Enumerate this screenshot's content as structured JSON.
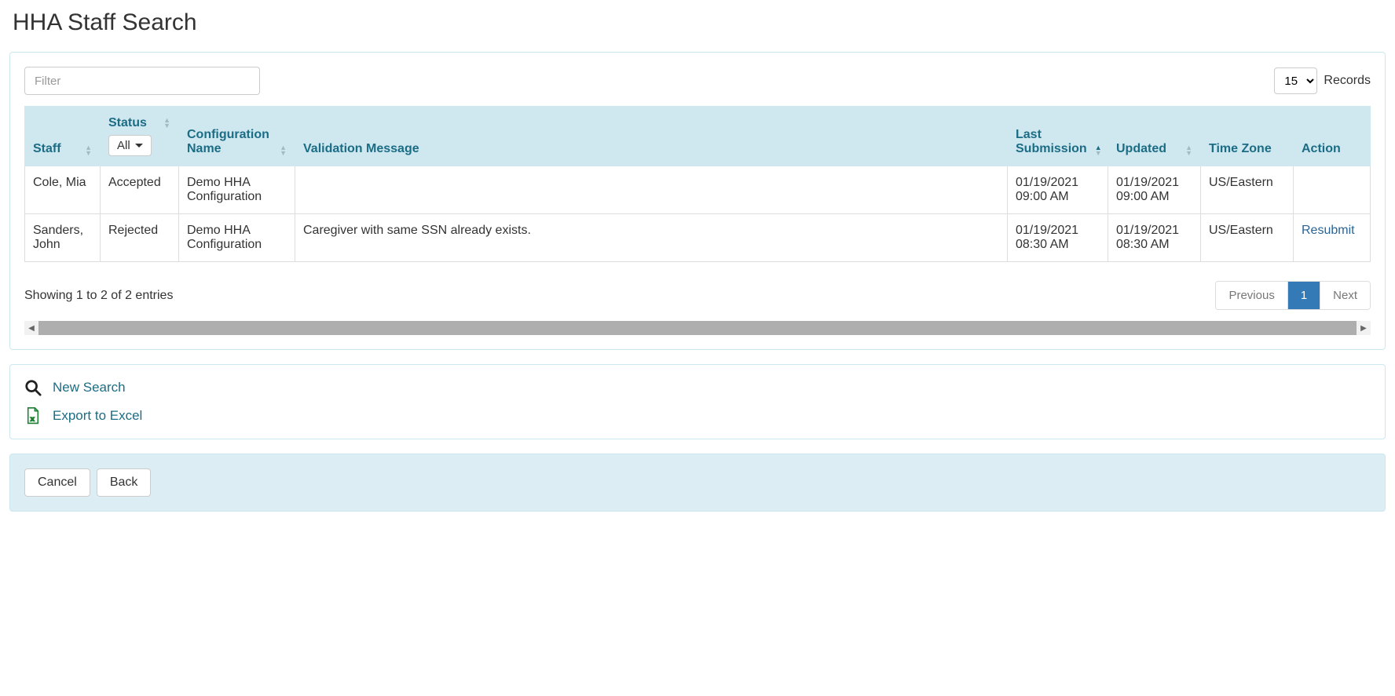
{
  "title": "HHA Staff Search",
  "filter_placeholder": "Filter",
  "records": {
    "value": "15",
    "label": "Records"
  },
  "columns": {
    "staff": "Staff",
    "status": "Status",
    "config": "Configuration Name",
    "validation": "Validation Message",
    "last_submission": "Last Submission",
    "updated": "Updated",
    "timezone": "Time Zone",
    "action": "Action"
  },
  "status_filter": "All",
  "rows": [
    {
      "staff": "Cole, Mia",
      "status": "Accepted",
      "config": "Demo HHA Configuration",
      "validation": "",
      "last_submission": "01/19/2021 09:00 AM",
      "updated": "01/19/2021 09:00 AM",
      "timezone": "US/Eastern",
      "action": ""
    },
    {
      "staff": "Sanders, John",
      "status": "Rejected",
      "config": "Demo HHA Configuration",
      "validation": "Caregiver with same SSN already exists.",
      "last_submission": "01/19/2021 08:30 AM",
      "updated": "01/19/2021 08:30 AM",
      "timezone": "US/Eastern",
      "action": "Resubmit"
    }
  ],
  "showing": "Showing 1 to 2 of 2 entries",
  "pagination": {
    "previous": "Previous",
    "page": "1",
    "next": "Next"
  },
  "actions": {
    "new_search": "New Search",
    "export_excel": "Export to Excel"
  },
  "footer": {
    "cancel": "Cancel",
    "back": "Back"
  }
}
